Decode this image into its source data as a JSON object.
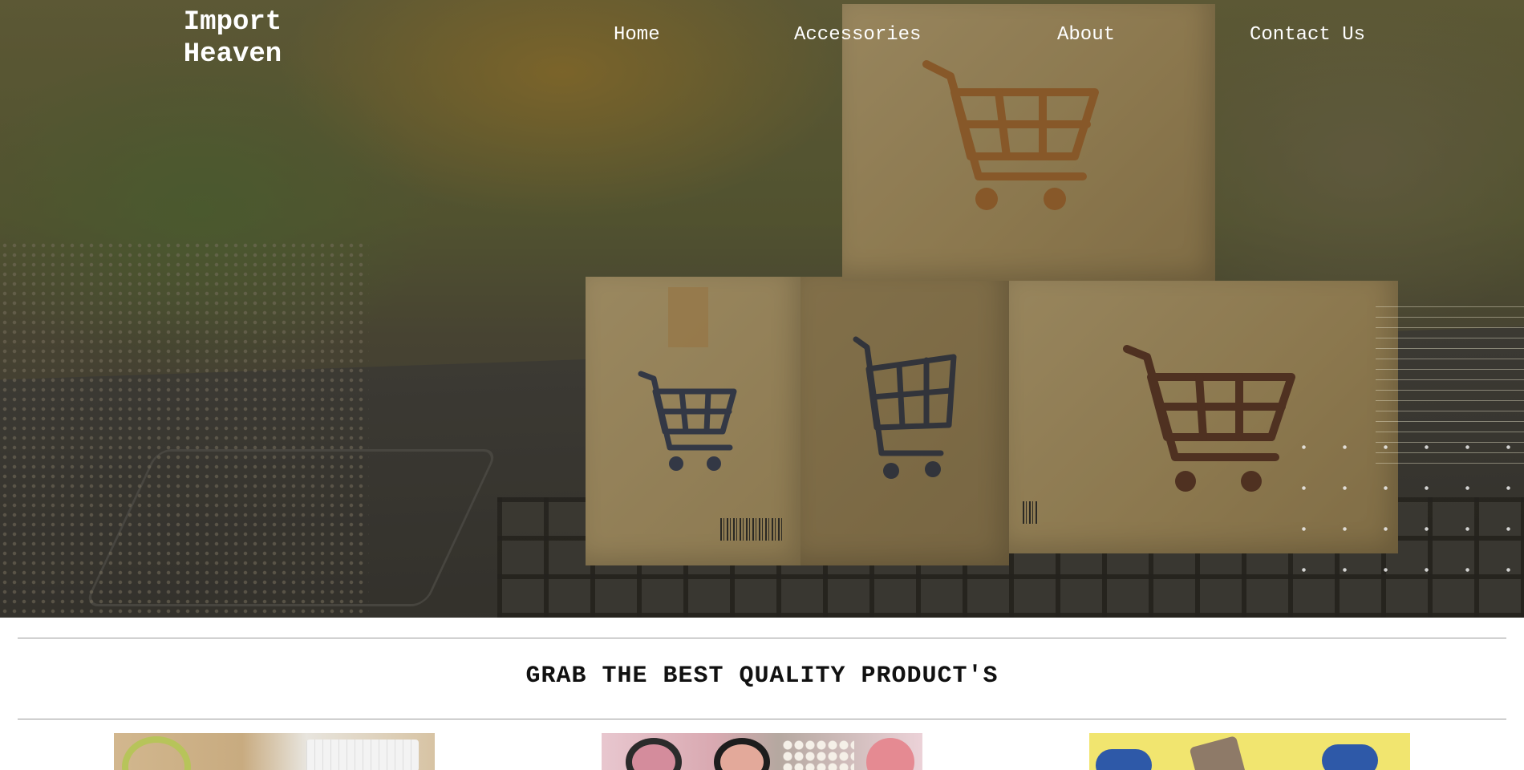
{
  "brand": {
    "line1": "Import",
    "line2": "Heaven"
  },
  "nav": {
    "items": [
      "Home",
      "Accessories",
      "About",
      "Contact Us"
    ]
  },
  "section": {
    "title": "GRAB THE BEST QUALITY PRODUCT'S"
  },
  "colors": {
    "nav_text": "#ffffff",
    "title_text": "#111111",
    "divider": "#999999"
  }
}
